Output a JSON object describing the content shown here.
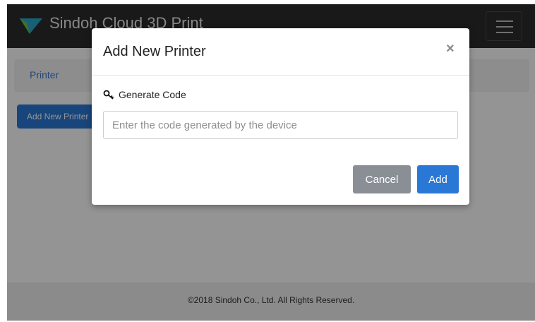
{
  "app": {
    "title": "Sindoh Cloud 3D Print",
    "brand_color": "#2b2b2b",
    "logo_icon": "sindoh-logo-icon"
  },
  "breadcrumb": {
    "items": [
      "Printer"
    ]
  },
  "page": {
    "add_button_label": "Add New Printer"
  },
  "footer": {
    "copyright": "©2018 Sindoh Co., Ltd. All Rights Reserved."
  },
  "modal": {
    "title": "Add New Printer",
    "close_label": "×",
    "field_label": "Generate Code",
    "field_icon": "key-icon",
    "input_placeholder": "Enter the code generated by the device",
    "input_value": "",
    "cancel_label": "Cancel",
    "add_label": "Add",
    "accent_color": "#2a78d6",
    "cancel_color": "#8a8f96"
  }
}
